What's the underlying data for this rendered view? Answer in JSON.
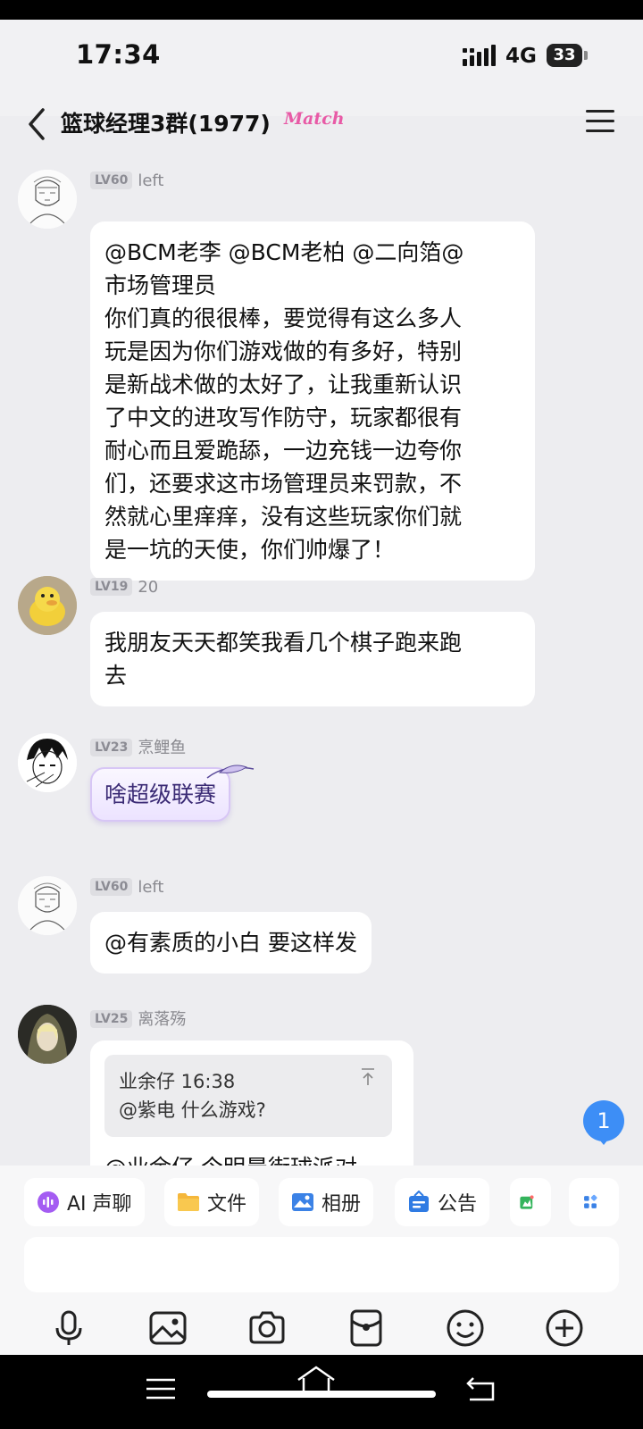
{
  "status_bar": {
    "time": "17:34",
    "network": "4G",
    "battery": "33"
  },
  "header": {
    "title": "篮球经理3群(1977)",
    "tag": "Match"
  },
  "messages": [
    {
      "level": "LV60",
      "name": "left",
      "lines": [
        "@BCM老李 @BCM老柏 @二向箔@",
        "市场管理员",
        "你们真的很很棒，要觉得有这么多人",
        "玩是因为你们游戏做的有多好，特别",
        "是新战术做的太好了，让我重新认识",
        "了中文的进攻写作防守，玩家都很有",
        "耐心而且爱跪舔，一边充钱一边夸你",
        "们，还要求这市场管理员来罚款，不",
        "然就心里痒痒，没有这些玩家你们就",
        "是一坑的天使，你们帅爆了！"
      ]
    },
    {
      "level": "LV19",
      "name": "20",
      "lines": [
        "我朋友天天都笑我看几个棋子跑来跑",
        "去"
      ]
    },
    {
      "level": "LV23",
      "name": "烹鲤鱼",
      "text": "啥超级联赛"
    },
    {
      "level": "LV60",
      "name": "left",
      "text": "@有素质的小白 要这样发"
    },
    {
      "level": "LV25",
      "name": "离落殇",
      "quote": {
        "author": "业余仔 16:38",
        "text": "@紫电 什么游戏?"
      },
      "partial_text": "@业余仔 今明晨街球派对"
    }
  ],
  "unread_count": "1",
  "toolbar": {
    "chips": [
      {
        "label": "AI 声聊",
        "icon": "ai-voice-icon"
      },
      {
        "label": "文件",
        "icon": "folder-icon"
      },
      {
        "label": "相册",
        "icon": "album-icon"
      },
      {
        "label": "公告",
        "icon": "announcement-icon"
      }
    ],
    "input_placeholder": ""
  },
  "colors": {
    "accent": "#3d8ef6",
    "match_tag": "#e85aa6",
    "bubble": "#ffffff",
    "background": "#ededf0"
  }
}
